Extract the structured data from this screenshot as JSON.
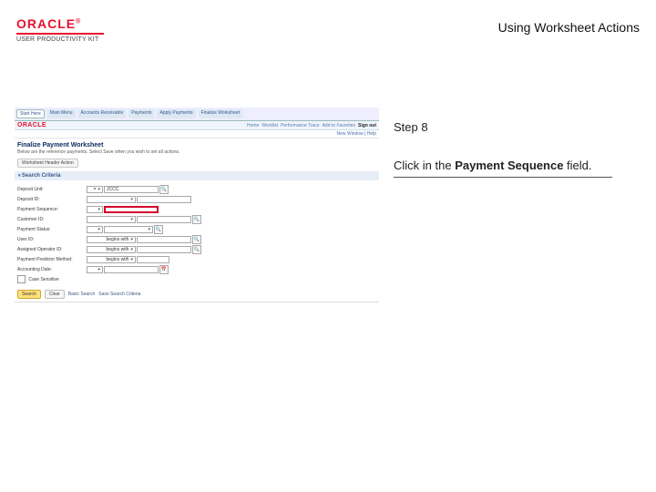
{
  "header": {
    "brand": "ORACLE",
    "tm": "®",
    "product_line": "USER PRODUCTIVITY KIT",
    "title": "Using Worksheet Actions"
  },
  "guidance": {
    "step_label": "Step 8",
    "instruction_prefix": "Click in the ",
    "instruction_bold": "Payment Sequence",
    "instruction_suffix": " field."
  },
  "screenshot": {
    "tabs": [
      "Start Here",
      "Main Menu",
      "Accounts Receivable",
      "Payments",
      "Apply Payments",
      "Finalize Worksheet"
    ],
    "bluebar_links": [
      "Home",
      "Worklist",
      "Performance Trace",
      "Add to Favorites",
      "Sign out"
    ],
    "status_line": "New Window | Help",
    "page_title": "Finalize Payment Worksheet",
    "helper_text": "Below are the reference payments.  Select Save when you wish to set all actions.",
    "section_btn": "Worksheet Header Action",
    "band_label": "Search Criteria",
    "fields": {
      "deposit_unit": {
        "label": "Deposit Unit:",
        "sel": "=",
        "val": "JCCC"
      },
      "deposit_id": {
        "label": "Deposit ID:",
        "sel": "",
        "val": ""
      },
      "payment_sequence": {
        "label": "Payment Sequence:",
        "sel": "",
        "val": ""
      },
      "customer_id": {
        "label": "Customer ID:",
        "sel": "",
        "val": ""
      },
      "payment_status": {
        "label": "Payment Status:",
        "sel": "",
        "val": ""
      },
      "user_id": {
        "label": "User ID:",
        "sel": "begins with",
        "val": ""
      },
      "assigned_oper_id": {
        "label": "Assigned Operator ID:",
        "sel": "begins with",
        "val": ""
      },
      "payment_method": {
        "label": "Payment Predictor Method:",
        "sel": "begins with",
        "val": ""
      },
      "accounting_date": {
        "label": "Accounting Date:",
        "sel": "",
        "val": ""
      }
    },
    "case_sensitive": "Case Sensitive",
    "buttons": {
      "search": "Search",
      "clear": "Clear",
      "basic": "Basic Search",
      "save": "Save Search Criteria"
    }
  }
}
